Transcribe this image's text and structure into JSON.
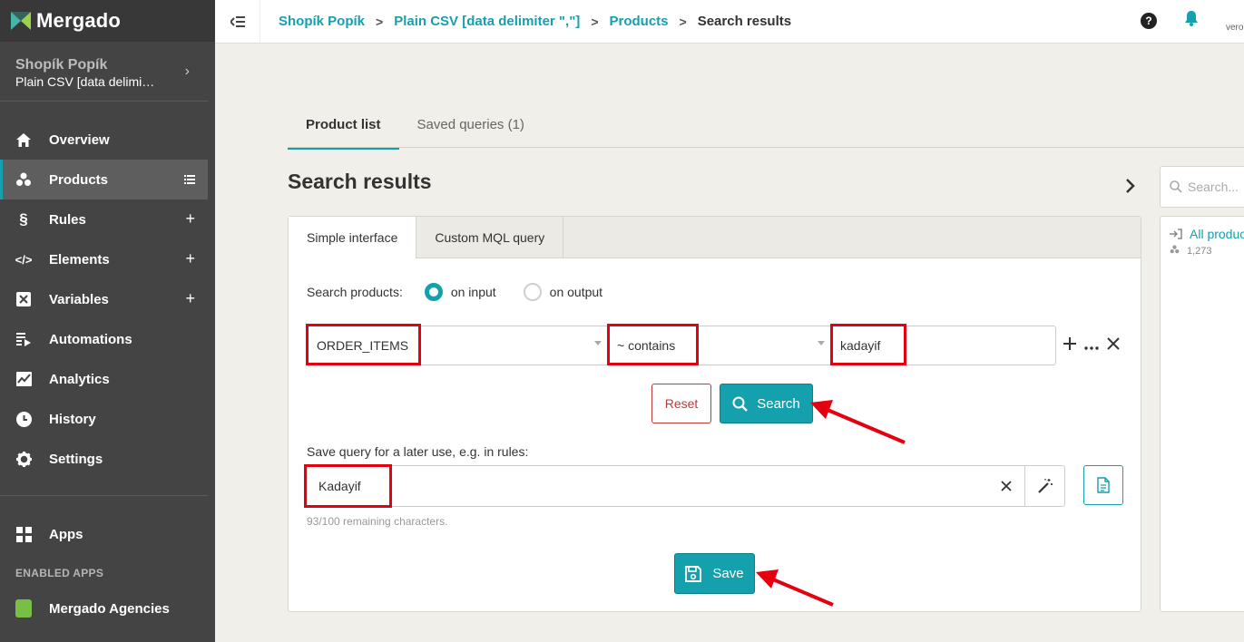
{
  "app": {
    "name": "Mergado"
  },
  "shop": {
    "name": "Shopík Popík",
    "feed": "Plain CSV [data delimi…"
  },
  "sidebar": {
    "items": [
      {
        "label": "Overview",
        "icon": "home-icon",
        "action": ""
      },
      {
        "label": "Products",
        "icon": "products-icon",
        "action": "list-icon",
        "active": true
      },
      {
        "label": "Rules",
        "icon": "section-icon",
        "action": "+"
      },
      {
        "label": "Elements",
        "icon": "code-icon",
        "action": "+"
      },
      {
        "label": "Variables",
        "icon": "variable-icon",
        "action": "+"
      },
      {
        "label": "Automations",
        "icon": "automations-icon",
        "action": ""
      },
      {
        "label": "Analytics",
        "icon": "chart-icon",
        "action": ""
      },
      {
        "label": "History",
        "icon": "clock-icon",
        "action": ""
      },
      {
        "label": "Settings",
        "icon": "gear-icon",
        "action": ""
      }
    ],
    "apps_label": "Apps",
    "enabled_apps_heading": "ENABLED APPS",
    "enabled_apps": [
      {
        "label": "Mergado Agencies"
      }
    ]
  },
  "breadcrumb": [
    "Shopík Popík",
    "Plain CSV [data delimiter \",\"]",
    "Products",
    "Search results"
  ],
  "topbar": {
    "user_text": "vero"
  },
  "tabs": [
    {
      "label": "Product list",
      "active": true
    },
    {
      "label": "Saved queries (1)"
    }
  ],
  "page_title": "Search results",
  "query_card": {
    "tabs": [
      {
        "label": "Simple interface",
        "active": true
      },
      {
        "label": "Custom MQL query"
      }
    ],
    "search_products_label": "Search products:",
    "mode_options": [
      {
        "label": "on input",
        "selected": true
      },
      {
        "label": "on output",
        "selected": false
      }
    ],
    "condition": {
      "element": "ORDER_ITEMS",
      "operator": "~ contains",
      "value": "kadayif"
    },
    "reset_label": "Reset",
    "search_label": "Search",
    "save_query_label": "Save query for a later use, e.g. in rules:",
    "save_query_value": "Kadayif",
    "remaining_chars": "93/100 remaining characters.",
    "save_label": "Save"
  },
  "right_panel": {
    "search_placeholder": "Search...",
    "items": [
      {
        "title": "All products",
        "count": "1,273"
      }
    ]
  },
  "colors": {
    "accent": "#14a1ad",
    "sidebar": "#444444",
    "highlight": "#e4000f",
    "danger": "#c03a3a"
  }
}
